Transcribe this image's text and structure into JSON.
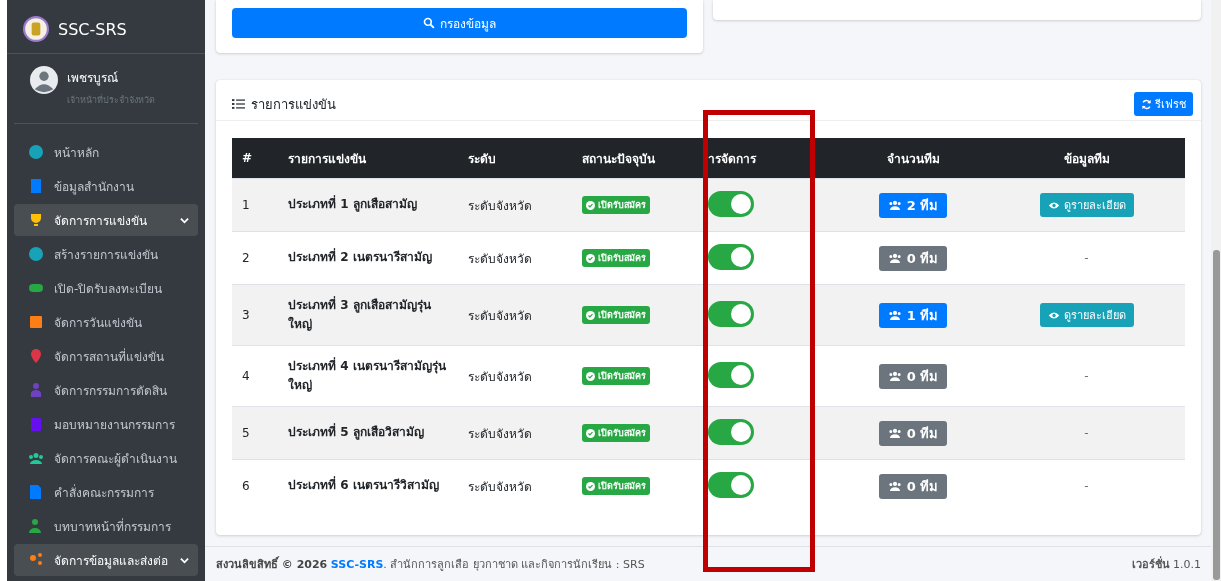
{
  "brand": {
    "title": "SSC-SRS"
  },
  "user": {
    "name": "เพชรบูรณ์",
    "role": "เจ้าหน้าที่ประจำจังหวัด"
  },
  "sidebar": {
    "items": [
      {
        "label": "หน้าหลัก",
        "selected": false,
        "expandable": false
      },
      {
        "label": "ข้อมูลสำนักงาน",
        "selected": false,
        "expandable": false
      },
      {
        "label": "จัดการการแข่งขัน",
        "selected": true,
        "expandable": true
      },
      {
        "label": "สร้างรายการแข่งขัน",
        "selected": false,
        "expandable": false
      },
      {
        "label": "เปิด-ปิดรับลงทะเบียน",
        "selected": false,
        "expandable": false
      },
      {
        "label": "จัดการวันแข่งขัน",
        "selected": false,
        "expandable": false
      },
      {
        "label": "จัดการสถานที่แข่งขัน",
        "selected": false,
        "expandable": false
      },
      {
        "label": "จัดการกรรมการตัดสิน",
        "selected": false,
        "expandable": false
      },
      {
        "label": "มอบหมายงานกรรมการ",
        "selected": false,
        "expandable": false
      },
      {
        "label": "จัดการคณะผู้ดำเนินงาน",
        "selected": false,
        "expandable": false
      },
      {
        "label": "คำสั่งคณะกรรมการ",
        "selected": false,
        "expandable": false
      },
      {
        "label": "บทบาทหน้าที่กรรมการ",
        "selected": false,
        "expandable": false
      },
      {
        "label": "จัดการข้อมูลและส่งต่อ",
        "selected": true,
        "expandable": true
      }
    ]
  },
  "filter": {
    "button": "กรองข้อมูล"
  },
  "competitions": {
    "title": "รายการแข่งขัน",
    "refresh": "รีเฟรช",
    "columns": [
      "#",
      "รายการแข่งขัน",
      "ระดับ",
      "สถานะปัจจุบัน",
      "ารจัดการ",
      "จำนวนทีม",
      "ข้อมูลทีม"
    ],
    "rows": [
      {
        "no": "1",
        "name": "ประเภทที่ 1 ลูกเสือสามัญ",
        "level": "ระดับจังหวัด",
        "status": "เปิดรับสมัคร",
        "on": true,
        "teams": {
          "label": "2 ทีม",
          "kind": "primary"
        },
        "info": {
          "kind": "button",
          "label": "ดูรายละเอียด"
        }
      },
      {
        "no": "2",
        "name": "ประเภทที่ 2 เนตรนารีสามัญ",
        "level": "ระดับจังหวัด",
        "status": "เปิดรับสมัคร",
        "on": true,
        "teams": {
          "label": "0 ทีม",
          "kind": "secondary"
        },
        "info": {
          "kind": "text",
          "label": "-"
        }
      },
      {
        "no": "3",
        "name": "ประเภทที่ 3 ลูกเสือสามัญรุ่นใหญ่",
        "level": "ระดับจังหวัด",
        "status": "เปิดรับสมัคร",
        "on": true,
        "teams": {
          "label": "1 ทีม",
          "kind": "primary"
        },
        "info": {
          "kind": "button",
          "label": "ดูรายละเอียด"
        }
      },
      {
        "no": "4",
        "name": "ประเภทที่ 4 เนตรนารีสามัญรุ่นใหญ่",
        "level": "ระดับจังหวัด",
        "status": "เปิดรับสมัคร",
        "on": true,
        "teams": {
          "label": "0 ทีม",
          "kind": "secondary"
        },
        "info": {
          "kind": "text",
          "label": "-"
        }
      },
      {
        "no": "5",
        "name": "ประเภทที่ 5 ลูกเสือวิสามัญ",
        "level": "ระดับจังหวัด",
        "status": "เปิดรับสมัคร",
        "on": true,
        "teams": {
          "label": "0 ทีม",
          "kind": "secondary"
        },
        "info": {
          "kind": "text",
          "label": "-"
        }
      },
      {
        "no": "6",
        "name": "ประเภทที่ 6 เนตรนารีวิสามัญ",
        "level": "ระดับจังหวัด",
        "status": "เปิดรับสมัคร",
        "on": true,
        "teams": {
          "label": "0 ทีม",
          "kind": "secondary"
        },
        "info": {
          "kind": "text",
          "label": "-"
        }
      }
    ]
  },
  "footer": {
    "prefix": "สงวนลิขสิทธิ์ © 2026",
    "link": "SSC-SRS",
    "suffix": ". สำนักการลูกเสือ ยุวกาชาด และกิจการนักเรียน : SRS",
    "version": "**เวอร์ชั่น** 1.0.1"
  }
}
